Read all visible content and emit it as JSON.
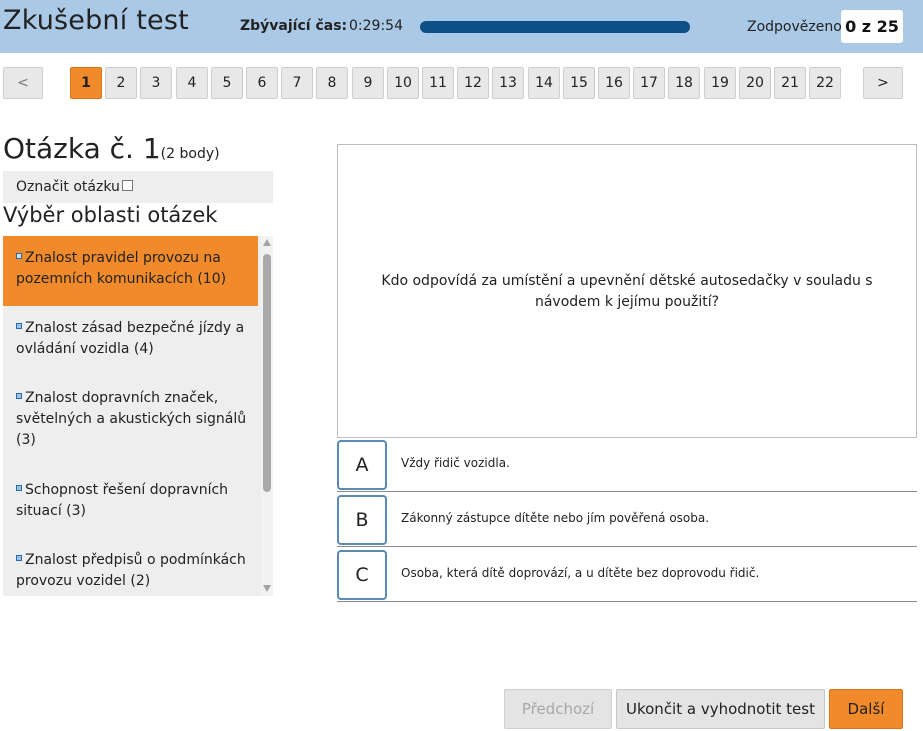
{
  "header": {
    "title": "Zkušební test",
    "time_label": "Zbývající čas:",
    "time_value": "0:29:54",
    "answered_label": "Zodpovězeno",
    "answered_value": "0 z 25",
    "progress_fraction": 1.0,
    "accent_color": "#a9c9e6",
    "progress_color": "#0d4f87"
  },
  "nav": {
    "prev_label": "<",
    "next_label": ">",
    "questions": [
      "1",
      "2",
      "3",
      "4",
      "5",
      "6",
      "7",
      "8",
      "9",
      "10",
      "11",
      "12",
      "13",
      "14",
      "15",
      "16",
      "17",
      "18",
      "19",
      "20",
      "21",
      "22"
    ],
    "active_question": "1",
    "active_color": "#f18a2a"
  },
  "question": {
    "heading": "Otázka č. 1",
    "points": "(2 body)",
    "mark_label": "Označit otázku",
    "text": "Kdo odpovídá za umístění a upevnění dětské autosedačky v souladu s návodem k jejímu použití?"
  },
  "areas": {
    "title": "Výběr oblasti otázek",
    "items": [
      {
        "label": "Znalost pravidel provozu na pozemních komunikacích (10)",
        "active": true
      },
      {
        "label": "Znalost zásad bezpečné jízdy a ovládání vozidla (4)",
        "active": false
      },
      {
        "label": "Znalost dopravních značek, světelných a akustických signálů (3)",
        "active": false
      },
      {
        "label": "Schopnost řešení dopravních situací (3)",
        "active": false
      },
      {
        "label": "Znalost předpisů o podmínkách provozu vozidel (2)",
        "active": false
      }
    ]
  },
  "answers": [
    {
      "letter": "A",
      "text": "Vždy řidič vozidla."
    },
    {
      "letter": "B",
      "text": "Zákonný zástupce dítěte nebo jím pověřená osoba."
    },
    {
      "letter": "C",
      "text": "Osoba, která dítě doprovází, a u dítěte bez doprovodu řidič."
    }
  ],
  "footer": {
    "prev_label": "Předchozí",
    "finish_label": "Ukončit a vyhodnotit test",
    "next_label": "Další"
  }
}
